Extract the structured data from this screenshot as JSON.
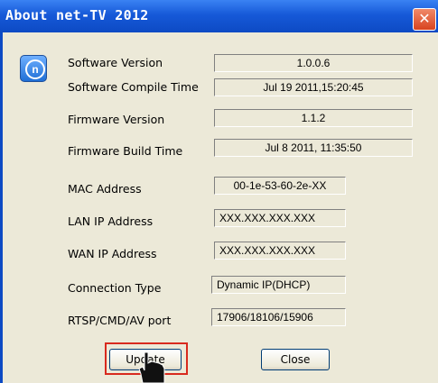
{
  "window": {
    "title": "About net-TV 2012",
    "close_glyph": "✕"
  },
  "app_icon": {
    "name": "net-tv-logo-icon",
    "glyph": "n"
  },
  "rows": [
    {
      "label": "Software Version",
      "value": "1.0.0.6"
    },
    {
      "label": "Software Compile Time",
      "value": "Jul 19 2011,15:20:45"
    },
    {
      "label": "Firmware Version",
      "value": "1.1.2"
    },
    {
      "label": "Firmware Build Time",
      "value": "Jul  8 2011, 11:35:50"
    },
    {
      "label": "MAC Address",
      "value": "00-1e-53-60-2e-XX"
    },
    {
      "label": "LAN IP Address",
      "value": "XXX.XXX.XXX.XXX"
    },
    {
      "label": "WAN IP Address",
      "value": "XXX.XXX.XXX.XXX"
    },
    {
      "label": "Connection Type",
      "value": "Dynamic IP(DHCP)"
    },
    {
      "label": "RTSP/CMD/AV port",
      "value": "17906/18106/15906"
    }
  ],
  "buttons": {
    "update": "Update",
    "close": "Close"
  },
  "colors": {
    "title_bar": "#0d4ac4",
    "client_bg": "#ece9d8",
    "highlight": "#d82a1e",
    "close_button": "#d8431f"
  }
}
